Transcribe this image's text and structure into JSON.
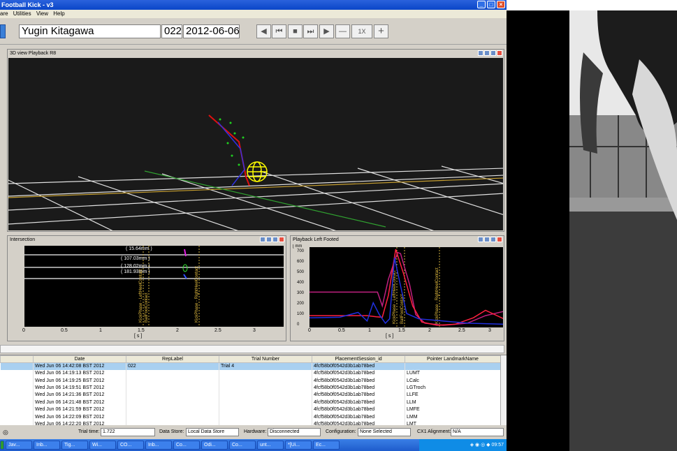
{
  "app": {
    "title": "Football Kick - v3",
    "menu": [
      "are",
      "Utilities",
      "View",
      "Help"
    ]
  },
  "toolbar": {
    "subject_name": "Yugin Kitagawa",
    "trial_id": "022",
    "date": "2012-06-06",
    "speed_label": "1X",
    "buttons": [
      "prev-icon",
      "rewind-icon",
      "stop-icon",
      "forward-icon",
      "play-icon",
      "minus-icon",
      "plus-icon"
    ]
  },
  "panels": {
    "view3d": {
      "title": "3D view Playback R8"
    },
    "intersection": {
      "title": "Intersection",
      "annotations": [
        "( 15.64mm )",
        "( 107.03mm )",
        "( 128.02mm )",
        "( 181.93mm )"
      ],
      "phase_labels": [
        "KickPhase - LeftHeelContact",
        "BallFootContact",
        "KickPhase - RightHeelContact"
      ],
      "x_ticks": [
        "0",
        "0.5",
        "1",
        "1.5",
        "2",
        "2.5",
        "3"
      ],
      "x_unit": "[ s ]"
    },
    "playback_left": {
      "title": "Playback Left Footed",
      "y_unit": "[ mm",
      "y_ticks": [
        "700",
        "600",
        "500",
        "400",
        "300",
        "200",
        "100",
        "0"
      ],
      "x_ticks": [
        "0",
        "0.5",
        "1",
        "1.5",
        "2",
        "2.5",
        "3"
      ],
      "x_unit": "[ s ]"
    }
  },
  "chart_data": {
    "type": "line",
    "x_label": "[ s ]",
    "y_label": "[ mm",
    "xlim": [
      0,
      3.2
    ],
    "ylim": [
      0,
      750
    ],
    "series": [
      {
        "color": "#c02080",
        "x": [
          0,
          0.95,
          1.12,
          1.2,
          1.3,
          1.45,
          1.5,
          1.65,
          1.75,
          1.9,
          2.2,
          2.6,
          2.9,
          3.2
        ],
        "y": [
          330,
          330,
          330,
          200,
          450,
          700,
          690,
          400,
          120,
          40,
          20,
          40,
          110,
          150
        ]
      },
      {
        "color": "#ff2040",
        "x": [
          0,
          0.5,
          0.95,
          1.1,
          1.2,
          1.3,
          1.42,
          1.55,
          1.7,
          1.85,
          2.1,
          2.4,
          2.7,
          2.9,
          3.2
        ],
        "y": [
          110,
          110,
          110,
          100,
          95,
          300,
          730,
          500,
          200,
          50,
          20,
          30,
          90,
          160,
          80
        ]
      },
      {
        "color": "#2030e0",
        "x": [
          0,
          0.5,
          0.8,
          0.95,
          1.05,
          1.15,
          1.25,
          1.32,
          1.4,
          1.6,
          1.8,
          2.2,
          2.6,
          3.2
        ],
        "y": [
          90,
          95,
          140,
          60,
          230,
          120,
          40,
          80,
          650,
          130,
          80,
          60,
          40,
          30
        ]
      }
    ]
  },
  "table": {
    "headers": [
      "",
      "Date",
      "RepLabel",
      "Trial Number",
      "PlacementSession_id",
      "Pointer LandmarkName"
    ],
    "rows": [
      [
        "",
        "Wed Jun 06 14:42:08 BST 2012",
        "022",
        "Trial 4",
        "4fcf58b0f0542d3b1ab78bed",
        ""
      ],
      [
        "",
        "Wed Jun 06 14:19:13 BST 2012",
        "",
        "",
        "4fcf58b0f0542d3b1ab78bed",
        "LUMT"
      ],
      [
        "",
        "Wed Jun 06 14:19:25 BST 2012",
        "",
        "",
        "4fcf58b0f0542d3b1ab78bed",
        "LCalc"
      ],
      [
        "",
        "Wed Jun 06 14:19:51 BST 2012",
        "",
        "",
        "4fcf58b0f0542d3b1ab78bed",
        "LGTroch"
      ],
      [
        "",
        "Wed Jun 06 14:21:36 BST 2012",
        "",
        "",
        "4fcf58b0f0542d3b1ab78bed",
        "LLFE"
      ],
      [
        "",
        "Wed Jun 06 14:21:48 BST 2012",
        "",
        "",
        "4fcf58b0f0542d3b1ab78bed",
        "LLM"
      ],
      [
        "",
        "Wed Jun 06 14:21:59 BST 2012",
        "",
        "",
        "4fcf58b0f0542d3b1ab78bed",
        "LMFE"
      ],
      [
        "",
        "Wed Jun 06 14:22:09 BST 2012",
        "",
        "",
        "4fcf58b0f0542d3b1ab78bed",
        "LMM"
      ],
      [
        "",
        "Wed Jun 06 14:22:20 BST 2012",
        "",
        "",
        "4fcf58b0f0542d3b1ab78bed",
        "LMT"
      ]
    ]
  },
  "status": {
    "trial_time_label": "Trial time:",
    "trial_time_value": "1.722",
    "data_store_label": "Data Store:",
    "data_store_value": "Local Data Store",
    "hardware_label": "Hardware:",
    "hardware_value": "Disconnected",
    "configuration_label": "Configuration:",
    "configuration_value": "None Selected",
    "cx1_label": "CX1 Alignment:",
    "cx1_value": "N/A"
  },
  "taskbar": {
    "items": [
      "Jav...",
      "Inb...",
      "Tig...",
      "Wi...",
      "CO...",
      "Inb...",
      "Co...",
      "Odi...",
      "Co...",
      "unt...",
      "*[Ui...",
      "Ec..."
    ],
    "clock": "09:57"
  }
}
